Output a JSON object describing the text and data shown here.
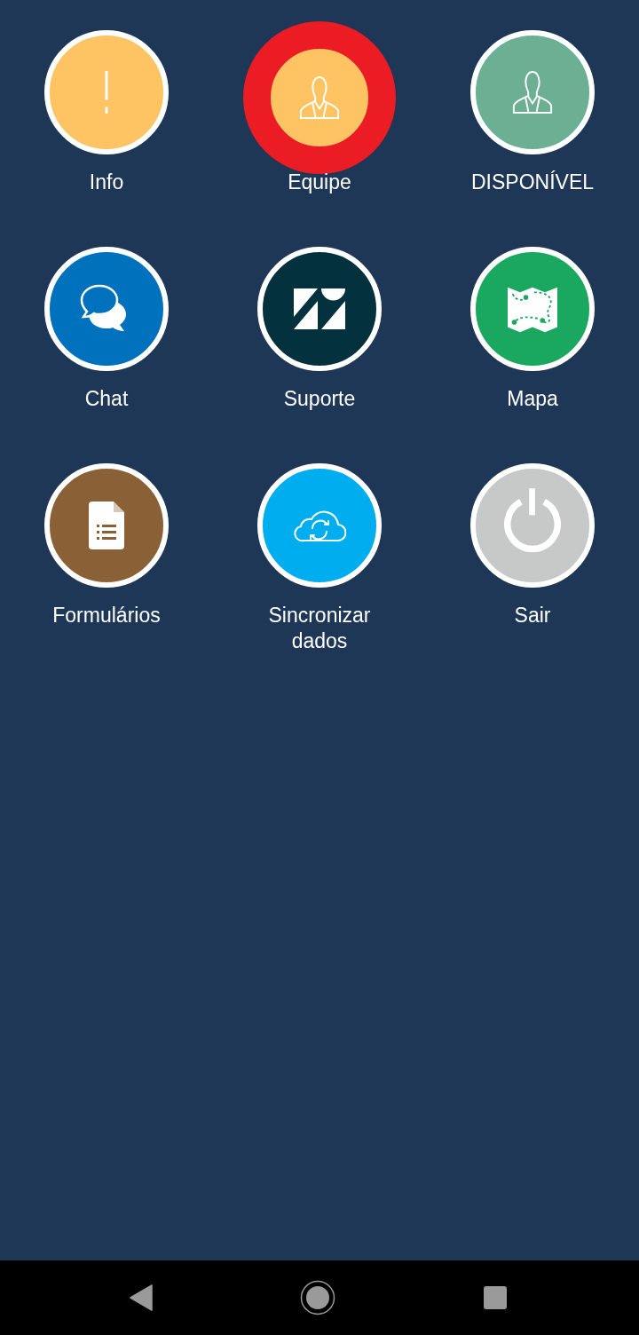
{
  "menu": [
    {
      "label": "Info",
      "kind": "info",
      "color": "#fec463",
      "highlighted": false
    },
    {
      "label": "Equipe",
      "kind": "person",
      "color": "#fec463",
      "highlighted": true
    },
    {
      "label": "DISPONÍVEL",
      "kind": "person",
      "color": "#6caf93",
      "highlighted": false
    },
    {
      "label": "Chat",
      "kind": "chat",
      "color": "#0071bc",
      "highlighted": false
    },
    {
      "label": "Suporte",
      "kind": "support",
      "color": "#03313d",
      "highlighted": false
    },
    {
      "label": "Mapa",
      "kind": "map",
      "color": "#1aa75f",
      "highlighted": false
    },
    {
      "label": "Formulários",
      "kind": "form",
      "color": "#8a6036",
      "highlighted": false
    },
    {
      "label": "Sincronizar dados",
      "kind": "sync",
      "color": "#00aeef",
      "highlighted": false
    },
    {
      "label": "Sair",
      "kind": "power",
      "color": "#c7c8c8",
      "highlighted": false
    }
  ]
}
